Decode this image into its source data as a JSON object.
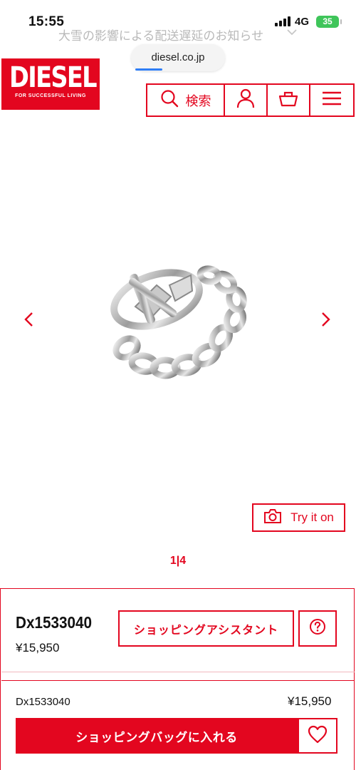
{
  "status_bar": {
    "time": "15:55",
    "network": "4G",
    "battery": "35"
  },
  "announcement": {
    "text": "大雪の影響による配送遅延のお知らせ"
  },
  "browser": {
    "url": "diesel.co.jp"
  },
  "header": {
    "logo_text": "DIESEL",
    "logo_tagline": "FOR SUCCESSFUL LIVING",
    "search_label": "検索"
  },
  "gallery": {
    "pager": "1|4",
    "try_on_label": "Try it on"
  },
  "product": {
    "name": "Dx1533040",
    "price": "¥15,950",
    "assistant_label": "ショッピングアシスタント"
  },
  "sticky_bar": {
    "name": "Dx1533040",
    "price": "¥15,950",
    "add_to_bag_label": "ショッピングバッグに入れる"
  },
  "colors": {
    "brand_red": "#e3061f",
    "url_progress": "#2f7ef6",
    "battery_green": "#3fc55a"
  },
  "icons": [
    "search-icon",
    "account-icon",
    "cart-icon",
    "menu-icon",
    "chevron-left-icon",
    "chevron-right-icon",
    "camera-icon",
    "help-icon",
    "heart-icon",
    "signal-icon",
    "battery-icon",
    "chevron-down-icon"
  ]
}
